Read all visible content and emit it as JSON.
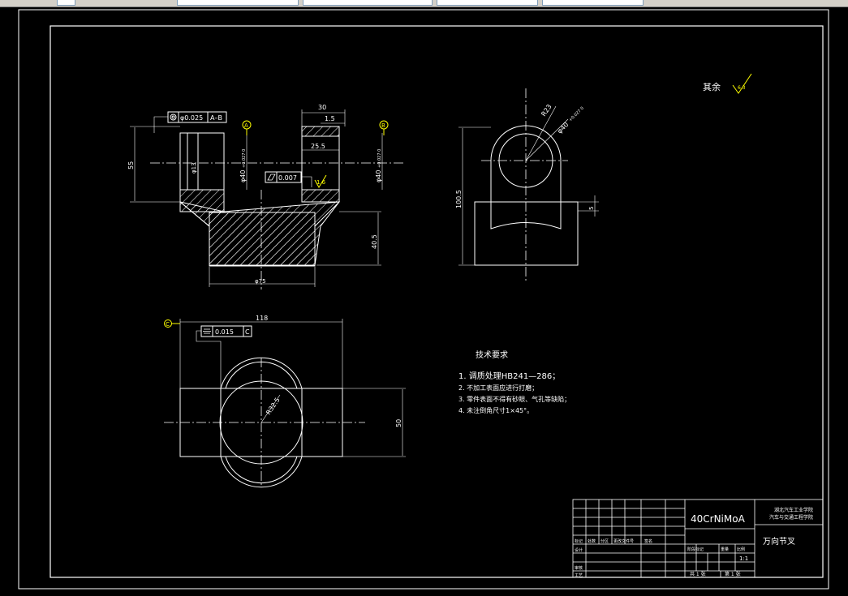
{
  "toolbar": {
    "fields": [
      "",
      "",
      "",
      "",
      ""
    ]
  },
  "drawing": {
    "surface_finish_note": "其余",
    "surface_finish_value": "6.3",
    "front_view": {
      "gdt_concentricity_value": "φ0.025",
      "gdt_concentricity_datum": "A–B",
      "datum_a": "A",
      "datum_b": "B",
      "dim_top_width": "30",
      "dim_chamfer": "1.5",
      "dim_inner_width": "25.5",
      "dim_height": "55",
      "dim_bore_left": "φ40",
      "dim_bore_left_tol": "+0.027 0",
      "dim_bore_right": "φ40",
      "dim_bore_right_tol": "+0.027 0",
      "dim_hole": "φ13",
      "gdt_flatness_value": "0.007",
      "surface_mark": "1.6",
      "dim_base_height": "40.5",
      "dim_base_dia": "φ75"
    },
    "side_view": {
      "dim_radius": "R23",
      "dim_bore": "φ40",
      "dim_bore_tol": "+0.027 0",
      "dim_total_height": "100.5",
      "dim_step": "5"
    },
    "top_view": {
      "datum_c": "C",
      "dim_width": "118",
      "gdt_symmetry_value": "0.015",
      "gdt_symmetry_datum": "C",
      "dim_radius": "R32.5",
      "dim_height": "50"
    },
    "tech_requirements": {
      "title": "技术要求",
      "items": [
        "1. 调质处理HB241—286；",
        "2. 不加工表面应进行打磨；",
        "3. 零件表面不得有砂眼、气孔等缺陷；",
        "4. 未注倒角尺寸1×45°。"
      ]
    },
    "title_block": {
      "material": "40CrNiMoA",
      "school": "湖北汽车工业学院",
      "dept": "汽车与交通工程学院",
      "part_name": "万向节叉",
      "scale": "1:1",
      "sheet_total": "共 1 张",
      "sheet_no": "第 1 张",
      "lbl_mark": "标记",
      "lbl_count": "处数",
      "lbl_zone": "分区",
      "lbl_change": "更改文件号",
      "lbl_sign": "签名",
      "lbl_design": "设计",
      "lbl_check": "审核",
      "lbl_process": "工艺",
      "lbl_stage": "阶段标记",
      "lbl_weight": "重量",
      "lbl_ratio": "比例"
    }
  }
}
